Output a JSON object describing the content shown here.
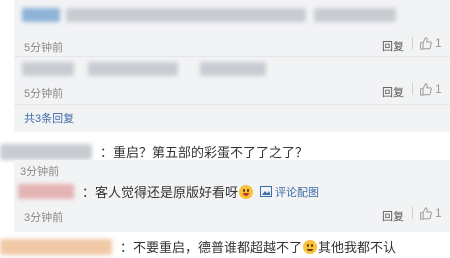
{
  "reply1": {
    "time": "5分钟前",
    "reply": "回复",
    "likes": "1"
  },
  "reply2": {
    "time": "5分钟前",
    "reply": "回复",
    "likes": "1"
  },
  "more_replies": "共3条回复",
  "comment1": {
    "text": "：重启？第五部的彩蛋不了了之了？"
  },
  "comment2": {
    "text": "：客人觉得还是原版好看呀",
    "comment_link": "评论配图",
    "time": "3分钟前",
    "reply": "回复",
    "likes": "1"
  },
  "comment3": {
    "text": "：不要重启，德普谁都超越不了",
    "text_after": "其他我都不认"
  },
  "colors": {
    "link": "#3e6ca6",
    "reply_bg": "#f2f3f5",
    "meta": "#888888"
  },
  "icons": [
    "thumbs-up-icon",
    "image-icon",
    "laugh-emoji-icon",
    "smile-emoji-icon"
  ]
}
